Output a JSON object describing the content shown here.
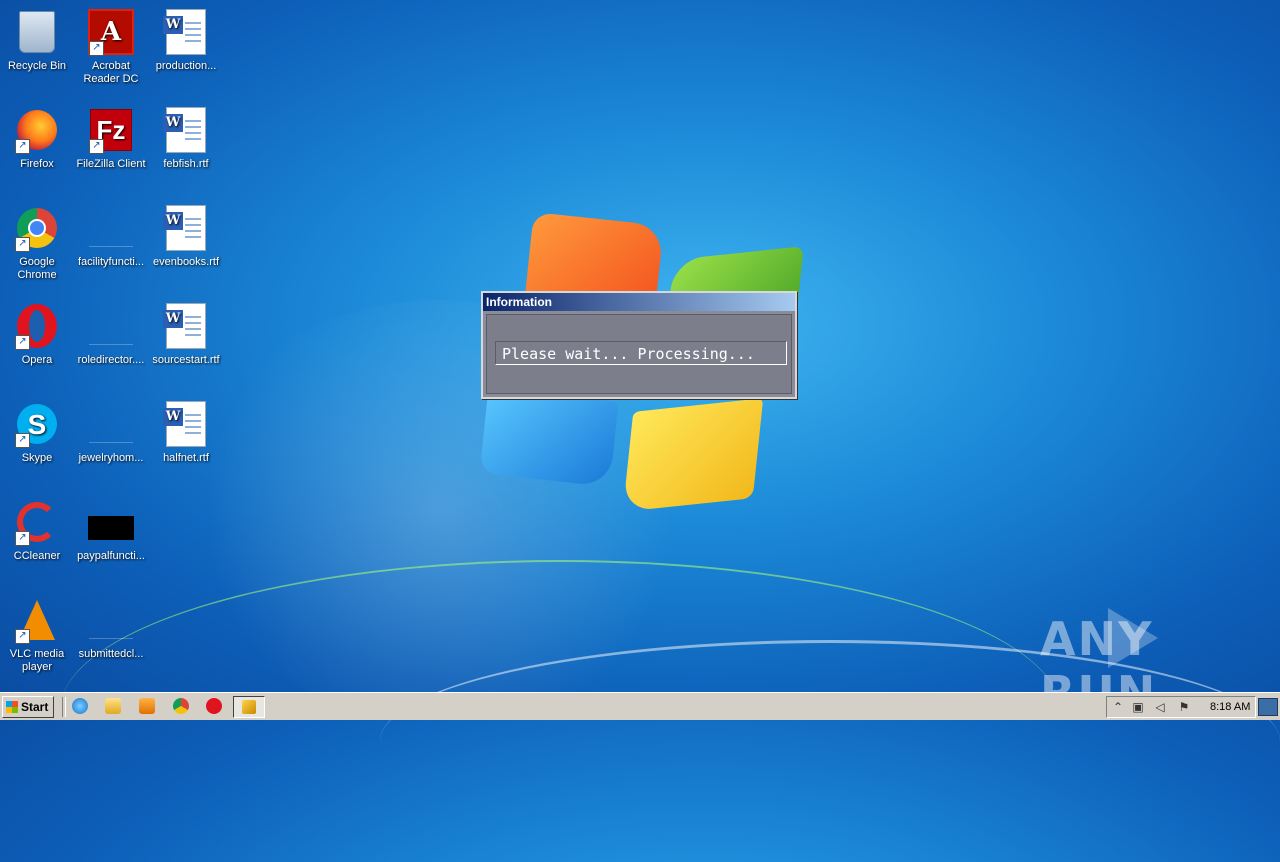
{
  "desktop": {
    "icons": [
      {
        "label": "Recycle Bin",
        "icon": "recycle-bin-icon"
      },
      {
        "label": "Acrobat Reader DC",
        "icon": "acrobat-icon"
      },
      {
        "label": "production...",
        "icon": "word-document-icon"
      },
      {
        "label": "Firefox",
        "icon": "firefox-icon"
      },
      {
        "label": "FileZilla Client",
        "icon": "filezilla-icon"
      },
      {
        "label": "febfish.rtf",
        "icon": "word-document-icon"
      },
      {
        "label": "Google Chrome",
        "icon": "chrome-icon"
      },
      {
        "label": "facilityfuncti...",
        "icon": "blank-file-icon"
      },
      {
        "label": "evenbooks.rtf",
        "icon": "word-document-icon"
      },
      {
        "label": "Opera",
        "icon": "opera-icon"
      },
      {
        "label": "roledirector....",
        "icon": "blank-file-icon"
      },
      {
        "label": "sourcestart.rtf",
        "icon": "word-document-icon"
      },
      {
        "label": "Skype",
        "icon": "skype-icon"
      },
      {
        "label": "jewelryhom...",
        "icon": "blank-file-icon"
      },
      {
        "label": "halfnet.rtf",
        "icon": "word-document-icon"
      },
      {
        "label": "CCleaner",
        "icon": "ccleaner-icon"
      },
      {
        "label": "paypalfuncti...",
        "icon": "black-image-file-icon"
      },
      {
        "label": "VLC media player",
        "icon": "vlc-icon"
      },
      {
        "label": "submittedcl...",
        "icon": "blank-file-icon"
      }
    ]
  },
  "dialog": {
    "title": "Information",
    "message": "Please wait... Processing..."
  },
  "watermark": {
    "text_left": "ANY",
    "text_right": "RUN"
  },
  "taskbar": {
    "start_label": "Start",
    "quick_launch": [
      "internet-explorer-icon",
      "explorer-folder-icon",
      "media-player-icon",
      "chrome-icon",
      "opera-icon"
    ],
    "active_task_icon": "running-app-icon",
    "tray_icons": [
      "chevron-up-icon",
      "network-icon",
      "volume-icon",
      "flag-icon"
    ],
    "clock": "8:18 AM"
  }
}
